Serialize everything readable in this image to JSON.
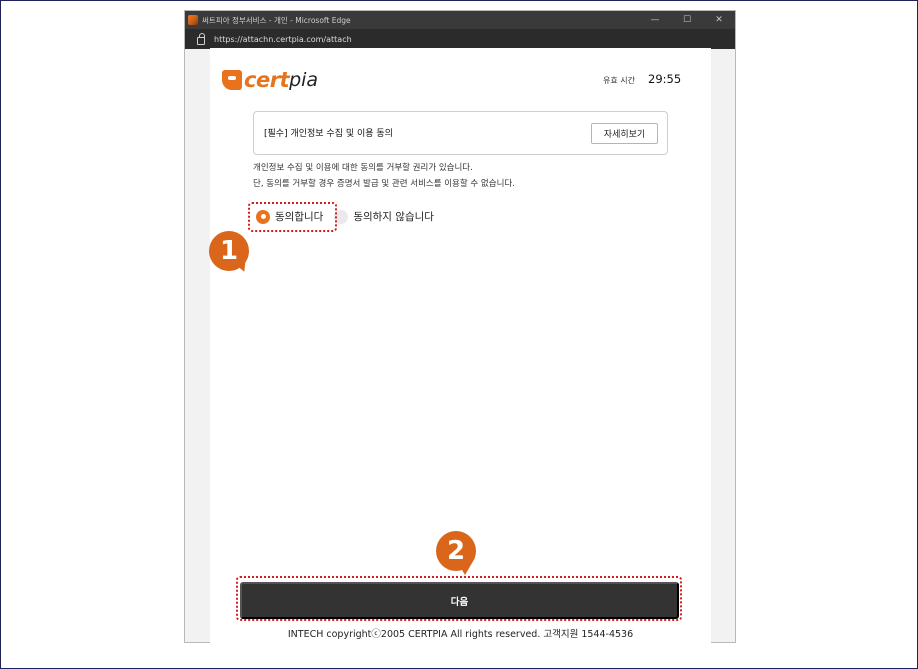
{
  "window": {
    "title": "써트피아 정부서비스 - 개인 - Microsoft Edge",
    "controls": {
      "minimize": "—",
      "maximize": "☐",
      "close": "✕"
    },
    "url": "https://attachn.certpia.com/attach"
  },
  "logo": {
    "brand_a": "cert",
    "brand_b": "pia"
  },
  "timer": {
    "label": "유효 시간",
    "value": "29:55"
  },
  "consent": {
    "title": "[필수] 개인정보 수집 및 이용 동의",
    "detail_button": "자세히보기",
    "notice_lines": [
      "개인정보 수집 및 이용에 대한 동의를 거부할 권리가 있습니다.",
      "단, 동의를 거부할 경우 증명서 발급 및 관련 서비스를 이용할 수 없습니다."
    ],
    "options": [
      {
        "label": "동의합니다",
        "selected": true
      },
      {
        "label": "동의하지 않습니다",
        "selected": false
      }
    ]
  },
  "next_button": "다음",
  "footer": "INTECH copyrightⓒ2005 CERTPIA All rights reserved. 고객지원 1544-4536",
  "annotations": {
    "step1": "1",
    "step2": "2"
  },
  "colors": {
    "accent": "#e8731c",
    "highlight": "#d81b1b",
    "button": "#333333"
  }
}
